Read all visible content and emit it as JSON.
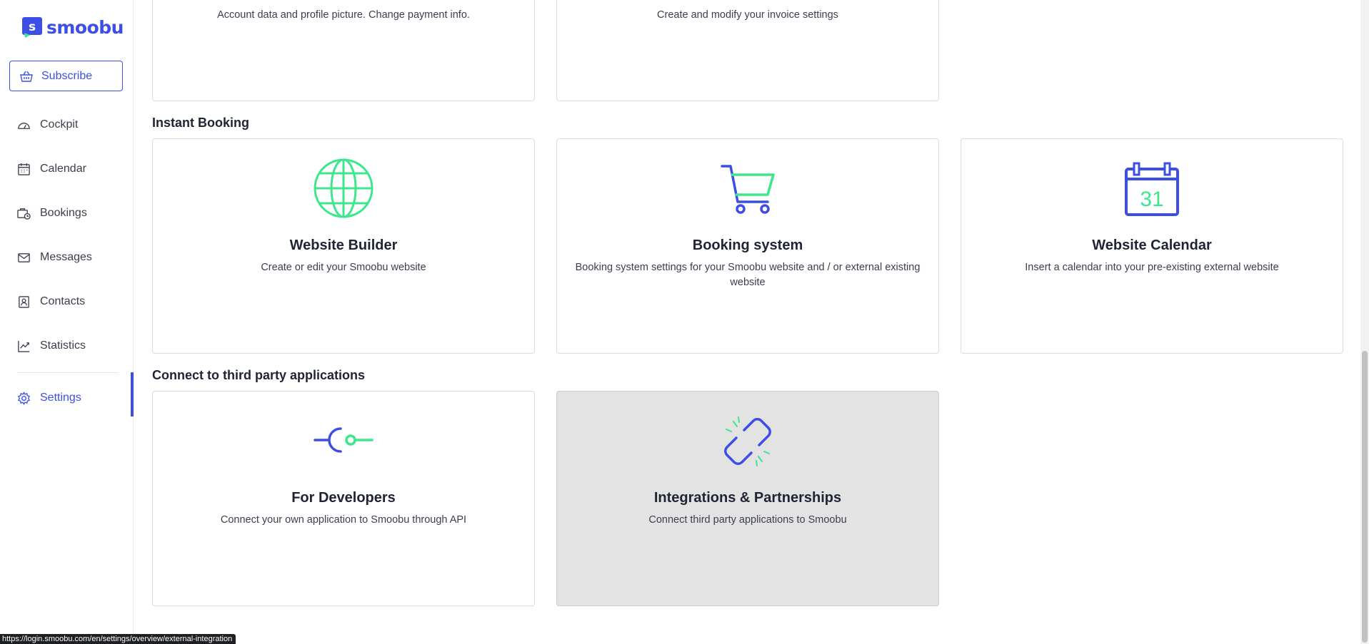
{
  "brand": {
    "name": "smoobu",
    "accent": "#3d4ee6",
    "green": "#3ee68c"
  },
  "sidebar": {
    "subscribe_label": "Subscribe",
    "items": [
      {
        "label": "Cockpit",
        "icon": "dashboard-icon"
      },
      {
        "label": "Calendar",
        "icon": "calendar-icon"
      },
      {
        "label": "Bookings",
        "icon": "bookings-icon"
      },
      {
        "label": "Messages",
        "icon": "mail-icon"
      },
      {
        "label": "Contacts",
        "icon": "contact-icon"
      },
      {
        "label": "Statistics",
        "icon": "chart-icon"
      }
    ],
    "settings_label": "Settings"
  },
  "top_cards": [
    {
      "desc": "Account data and profile picture. Change payment info."
    },
    {
      "desc": "Create and modify your invoice settings"
    }
  ],
  "sections": {
    "instant_booking": {
      "title": "Instant Booking",
      "cards": [
        {
          "title": "Website Builder",
          "desc": "Create or edit your Smoobu website",
          "icon": "globe-icon"
        },
        {
          "title": "Booking system",
          "desc": "Booking system settings for your Smoobu website and / or external existing website",
          "icon": "cart-icon"
        },
        {
          "title": "Website Calendar",
          "desc": "Insert a calendar into your pre-existing external website",
          "icon": "calendar-31-icon",
          "icon_text": "31"
        }
      ]
    },
    "third_party": {
      "title": "Connect to third party applications",
      "cards": [
        {
          "title": "For Developers",
          "desc": "Connect your own application to Smoobu through API",
          "icon": "api-connector-icon"
        },
        {
          "title": "Integrations & Partnerships",
          "desc": "Connect third party applications to Smoobu",
          "icon": "broken-link-icon"
        }
      ]
    }
  },
  "status_url": "https://login.smoobu.com/en/settings/overview/external-integration"
}
